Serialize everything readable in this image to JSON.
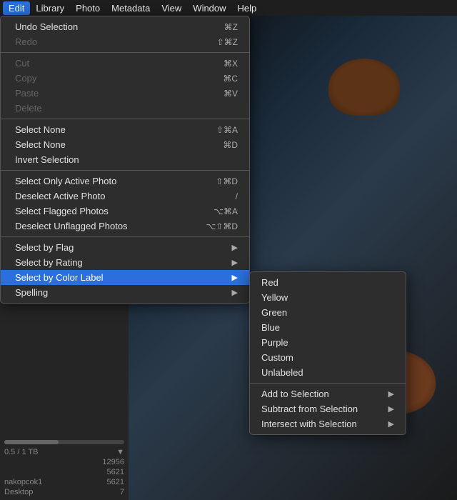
{
  "menubar": {
    "items": [
      {
        "label": "Edit",
        "active": true
      },
      {
        "label": "Library"
      },
      {
        "label": "Photo"
      },
      {
        "label": "Metadata"
      },
      {
        "label": "View"
      },
      {
        "label": "Window"
      },
      {
        "label": "Help"
      }
    ]
  },
  "edit_menu": {
    "items": [
      {
        "label": "Undo Selection",
        "shortcut": "⌘Z",
        "disabled": false,
        "separator_after": true
      },
      {
        "label": "Redo",
        "shortcut": "⇧⌘Z",
        "disabled": true,
        "separator_after": true
      },
      {
        "label": "Cut",
        "shortcut": "⌘X",
        "disabled": true
      },
      {
        "label": "Copy",
        "shortcut": "⌘C",
        "disabled": true
      },
      {
        "label": "Paste",
        "shortcut": "⌘V",
        "disabled": true
      },
      {
        "label": "Delete",
        "shortcut": "",
        "disabled": true,
        "separator_after": true
      },
      {
        "label": "Select None",
        "shortcut": "⇧⌘A"
      },
      {
        "label": "Select None",
        "shortcut": "⌘D"
      },
      {
        "label": "Invert Selection",
        "shortcut": "",
        "separator_after": true
      },
      {
        "label": "Select Only Active Photo",
        "shortcut": "⇧⌘D"
      },
      {
        "label": "Deselect Active Photo",
        "shortcut": "/"
      },
      {
        "label": "Select Flagged Photos",
        "shortcut": "⌥⌘A"
      },
      {
        "label": "Deselect Unflagged Photos",
        "shortcut": "⌥⇧⌘D",
        "separator_after": true
      },
      {
        "label": "Select by Flag",
        "shortcut": "",
        "has_arrow": true
      },
      {
        "label": "Select by Rating",
        "shortcut": "",
        "has_arrow": true
      },
      {
        "label": "Select by Color Label",
        "shortcut": "",
        "has_arrow": true,
        "highlighted": true
      },
      {
        "label": "Spelling",
        "shortcut": "",
        "has_arrow": true
      }
    ]
  },
  "color_label_submenu": {
    "items": [
      {
        "label": "Red"
      },
      {
        "label": "Yellow"
      },
      {
        "label": "Green"
      },
      {
        "label": "Blue"
      },
      {
        "label": "Purple"
      },
      {
        "label": "Custom"
      },
      {
        "label": "Unlabeled",
        "separator_after": true
      },
      {
        "label": "Add to Selection",
        "has_arrow": true
      },
      {
        "label": "Subtract from Selection",
        "has_arrow": true
      },
      {
        "label": "Intersect with Selection",
        "has_arrow": true
      }
    ]
  },
  "panel": {
    "storage_label": "0.5 / 1 TB",
    "stats": [
      {
        "label": "",
        "value": "12956"
      },
      {
        "label": "",
        "value": "5621"
      },
      {
        "label": "nakopcok1",
        "value": "5621"
      },
      {
        "label": "Desktop",
        "value": "7"
      }
    ]
  }
}
